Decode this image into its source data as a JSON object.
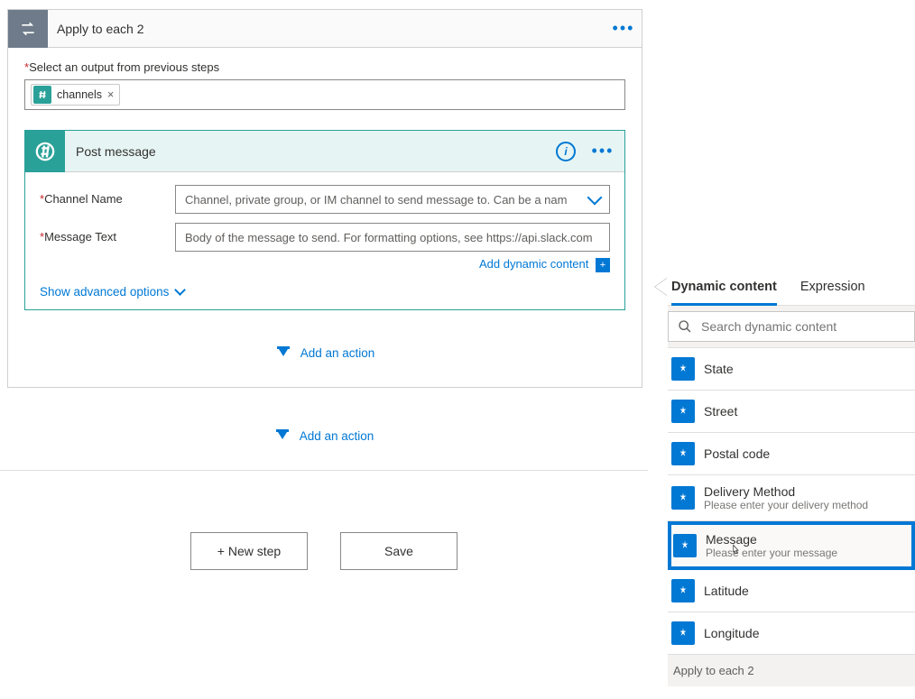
{
  "applyCard": {
    "title": "Apply to each 2",
    "outputLabel": "Select an output from previous steps",
    "token": {
      "name": "channels",
      "icon": "hash-icon"
    }
  },
  "postCard": {
    "title": "Post message",
    "fields": {
      "channel": {
        "label": "Channel Name",
        "placeholder": "Channel, private group, or IM channel to send message to. Can be a nam"
      },
      "message": {
        "label": "Message Text",
        "placeholder": "Body of the message to send. For formatting options, see https://api.slack.com"
      }
    },
    "addDynamic": "Add dynamic content",
    "showAdvanced": "Show advanced options"
  },
  "addAction": "Add an action",
  "footer": {
    "newStep": "+ New step",
    "save": "Save"
  },
  "dcPanel": {
    "tabs": {
      "dynamic": "Dynamic content",
      "expression": "Expression"
    },
    "searchPlaceholder": "Search dynamic content",
    "items": [
      {
        "label": "State"
      },
      {
        "label": "Street"
      },
      {
        "label": "Postal code"
      },
      {
        "label": "Delivery Method",
        "sub": "Please enter your delivery method"
      },
      {
        "label": "Message",
        "sub": "Please enter your message",
        "highlight": true
      },
      {
        "label": "Latitude"
      },
      {
        "label": "Longitude"
      }
    ],
    "section": "Apply to each 2"
  }
}
